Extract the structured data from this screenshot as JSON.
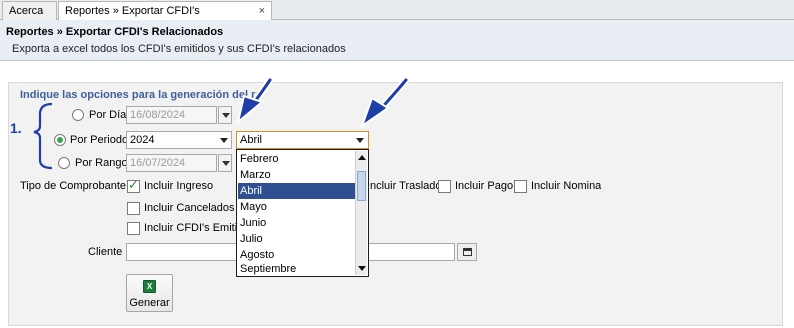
{
  "tabs": [
    {
      "label": "Acerca de"
    },
    {
      "label": "Reportes » Exportar CFDI's Relacionados",
      "close": "×"
    }
  ],
  "header": {
    "title": "Reportes » Exportar CFDI's Relacionados",
    "subtitle": "Exporta a excel todos los CFDI's emitidos y sus CFDI's relacionados"
  },
  "form": {
    "legend": "Indique las opciones para la generación del re",
    "annotation": "1.",
    "por_dia": {
      "label": "Por Día",
      "date": "16/08/2024",
      "selected": false
    },
    "por_periodo": {
      "label": "Por Periodo",
      "year": "2024",
      "month": "Abril",
      "selected": true
    },
    "por_rango": {
      "label": "Por Rango",
      "date": "16/07/2024",
      "selected": false
    },
    "tipo_label": "Tipo de Comprobante",
    "checks": {
      "incluir_ingreso": {
        "label": "Incluir Ingreso",
        "checked": true
      },
      "incluir_cancelados": {
        "label": "Incluir Cancelados",
        "checked": false
      },
      "incluir_emitidos": {
        "label": "Incluir CFDI's Emitid",
        "checked": false
      },
      "incluir_traslado": {
        "label": "ncluir Traslado",
        "checked": false
      },
      "incluir_pago": {
        "label": "Incluir Pago",
        "checked": false
      },
      "incluir_nomina": {
        "label": "Incluir Nomina",
        "checked": false
      }
    },
    "cliente_label": "Cliente",
    "generar_label": "Generar"
  },
  "month_list": {
    "items": [
      "Febrero",
      "Marzo",
      "Abril",
      "Mayo",
      "Junio",
      "Julio",
      "Agosto",
      "Septiembre"
    ],
    "selected": "Abril"
  },
  "colors": {
    "accent": "#3e5f9a",
    "selection": "#2e4f92",
    "arrow": "#1f3fa8"
  }
}
